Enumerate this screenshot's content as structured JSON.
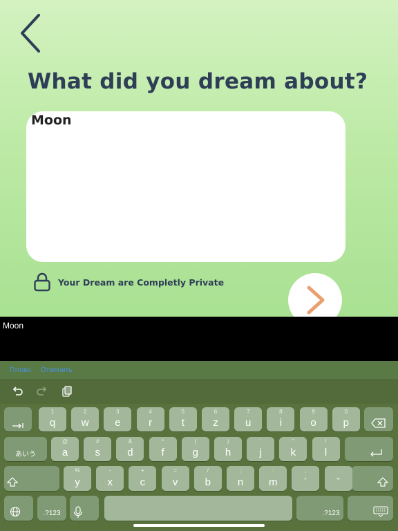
{
  "screen": {
    "title": "What did you dream about?",
    "dream_text": "Moon",
    "privacy_text": "Your Dream are Completly Private"
  },
  "preview": {
    "text": "Moon"
  },
  "keyboard": {
    "links": {
      "done": "Готово",
      "cancel": "Отменить"
    },
    "row1": [
      {
        "main": "q",
        "sub": "1"
      },
      {
        "main": "w",
        "sub": "2"
      },
      {
        "main": "e",
        "sub": "3"
      },
      {
        "main": "r",
        "sub": "4"
      },
      {
        "main": "t",
        "sub": "5"
      },
      {
        "main": "z",
        "sub": "6"
      },
      {
        "main": "u",
        "sub": "7"
      },
      {
        "main": "i",
        "sub": "8"
      },
      {
        "main": "o",
        "sub": "9"
      },
      {
        "main": "p",
        "sub": "0"
      }
    ],
    "row2": [
      {
        "main": "a",
        "sub": "@"
      },
      {
        "main": "s",
        "sub": "#"
      },
      {
        "main": "d",
        "sub": "&"
      },
      {
        "main": "f",
        "sub": "*"
      },
      {
        "main": "g",
        "sub": "("
      },
      {
        "main": "h",
        "sub": ")"
      },
      {
        "main": "j",
        "sub": "'"
      },
      {
        "main": "k",
        "sub": "\""
      },
      {
        "main": "l",
        "sub": "!"
      }
    ],
    "row3": [
      {
        "main": "y",
        "sub": "%"
      },
      {
        "main": "x",
        "sub": "-"
      },
      {
        "main": "c",
        "sub": "+"
      },
      {
        "main": "v",
        "sub": "="
      },
      {
        "main": "b",
        "sub": "/"
      },
      {
        "main": "n",
        "sub": ";"
      },
      {
        "main": "m",
        "sub": ":"
      },
      {
        "main": "´",
        "sub": ","
      },
      {
        "main": "ˇ",
        "sub": "."
      }
    ],
    "kana_label": "あいう",
    "numbers_left": ".?123",
    "numbers_right": ".?123",
    "icons": {
      "tab": "tab-icon",
      "delete": "backspace-icon",
      "return": "return-icon",
      "shift": "shift-icon",
      "globe": "globe-icon",
      "mic": "microphone-icon",
      "hide": "keyboard-hide-icon"
    }
  },
  "colors": {
    "title": "#2f3e57",
    "next_arrow": "#e9a071",
    "link": "#4a90e2"
  }
}
